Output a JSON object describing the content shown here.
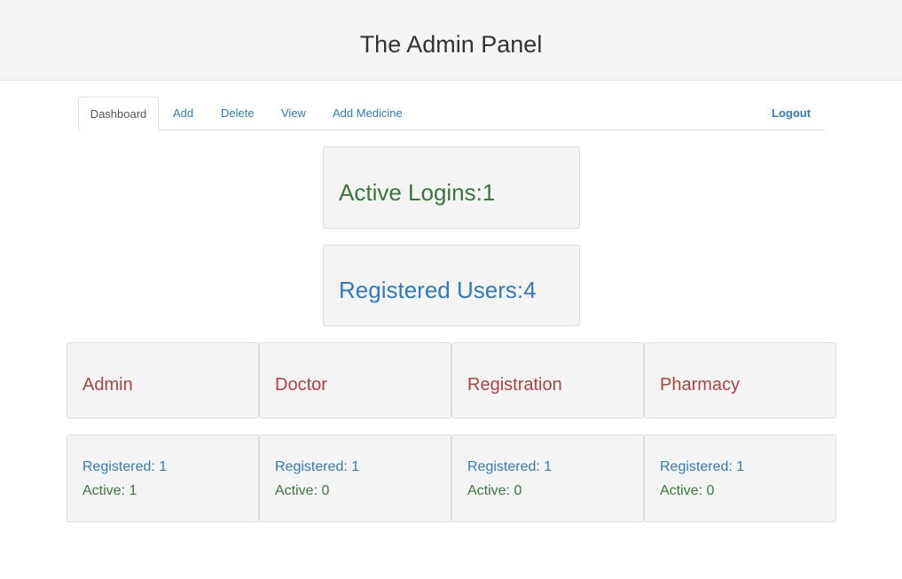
{
  "header": {
    "title": "The Admin Panel"
  },
  "nav": {
    "tabs": [
      "Dashboard",
      "Add",
      "Delete",
      "View",
      "Add Medicine"
    ],
    "logout": "Logout",
    "active": "Dashboard"
  },
  "stats": {
    "active_logins": "Active Logins:1",
    "registered_users": "Registered Users:4"
  },
  "roles": [
    {
      "name": "Admin",
      "registered": "Registered:  1",
      "active": "Active:  1"
    },
    {
      "name": "Doctor",
      "registered": "Registered:  1",
      "active": "Active:  0"
    },
    {
      "name": "Registration",
      "registered": "Registered:  1",
      "active": "Active:  0"
    },
    {
      "name": "Pharmacy",
      "registered": "Registered:  1",
      "active": "Active:  0"
    }
  ],
  "colors": {
    "active": "#3c763d",
    "registered": "#337ab7",
    "role": "#a94442",
    "link": "#337ab7"
  }
}
